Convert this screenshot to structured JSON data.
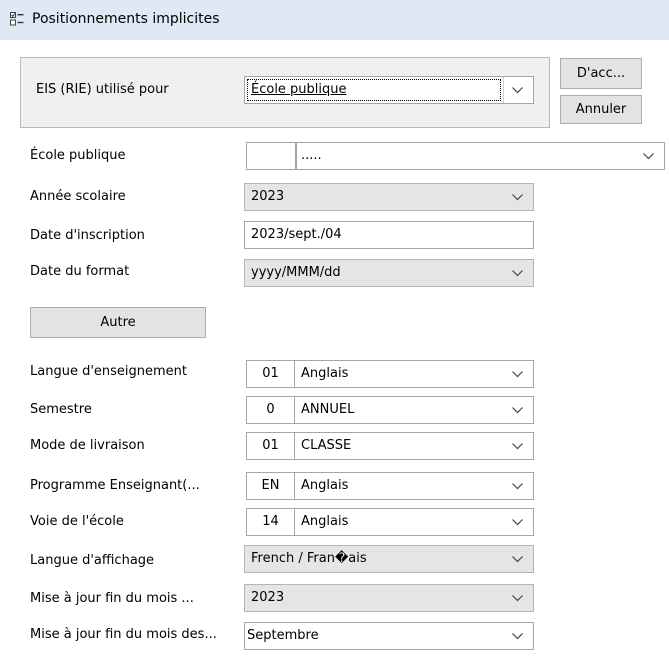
{
  "window": {
    "title": "Positionnements implicites"
  },
  "group": {
    "label": "EIS (RIE) utilisé pour",
    "value": "École publique"
  },
  "buttons": {
    "ok": "D'acc...",
    "cancel": "Annuler",
    "other": "Autre"
  },
  "fields": {
    "ecole": {
      "label": "École publique",
      "code": "",
      "value": "....."
    },
    "annee": {
      "label": "Année scolaire",
      "value": "2023"
    },
    "date_inscription": {
      "label": "Date d'inscription",
      "value": "2023/sept./04"
    },
    "date_format": {
      "label": "Date du format",
      "value": "yyyy/MMM/dd"
    },
    "langue_enseignement": {
      "label": "Langue d'enseignement",
      "code": "01",
      "value": "Anglais"
    },
    "semestre": {
      "label": "Semestre",
      "code": "0",
      "value": "ANNUEL"
    },
    "mode_livraison": {
      "label": "Mode de livraison",
      "code": "01",
      "value": "CLASSE"
    },
    "programme": {
      "label": "Programme Enseignant(...",
      "code": "EN",
      "value": "Anglais"
    },
    "voie": {
      "label": "Voie de l'école",
      "code": "14",
      "value": "Anglais"
    },
    "langue_affichage": {
      "label": "Langue d'affichage",
      "value": "French / Fran�ais"
    },
    "maj_fin_mois_annee": {
      "label": "Mise à jour fin du mois ...",
      "value": "2023"
    },
    "maj_fin_mois_des": {
      "label": "Mise à jour fin du mois des...",
      "value": "Septembre"
    }
  },
  "icons": {
    "window": "form-icon",
    "dropdown": "chevron-down-icon"
  }
}
